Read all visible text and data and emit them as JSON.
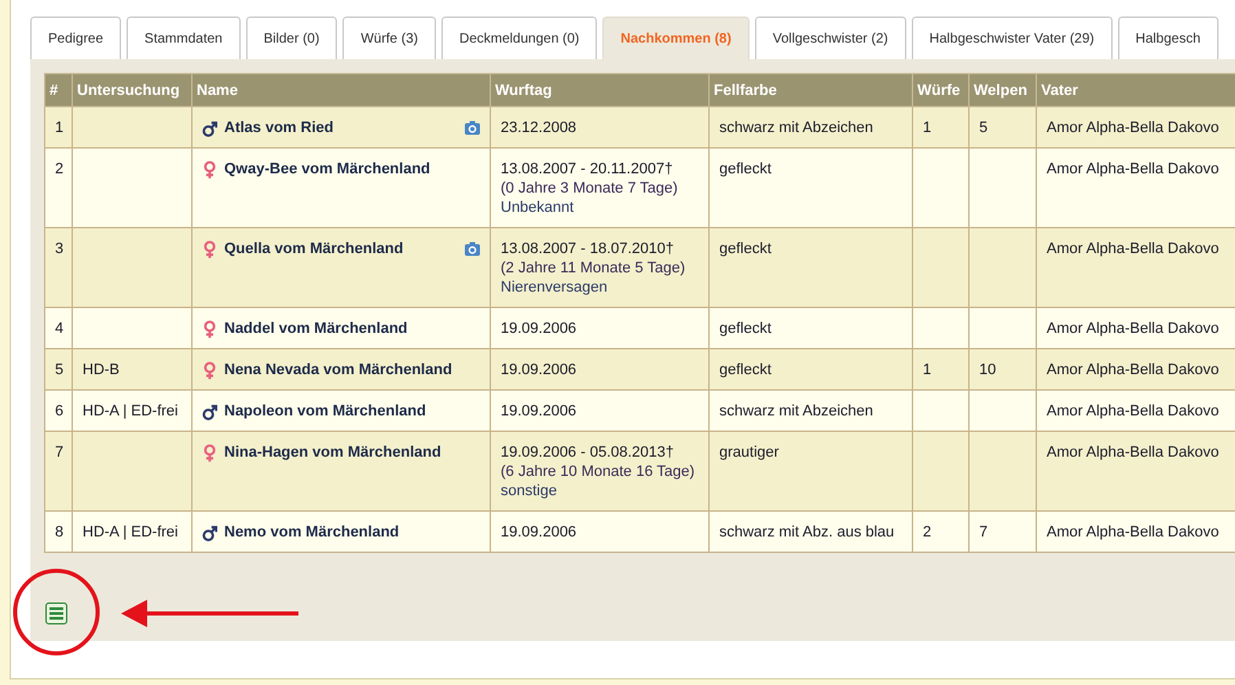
{
  "tabs": [
    {
      "label": "Pedigree",
      "selected": false
    },
    {
      "label": "Stammdaten",
      "selected": false
    },
    {
      "label": "Bilder (0)",
      "selected": false
    },
    {
      "label": "Würfe (3)",
      "selected": false
    },
    {
      "label": "Deckmeldungen (0)",
      "selected": false
    },
    {
      "label": "Nachkommen (8)",
      "selected": true
    },
    {
      "label": "Vollgeschwister (2)",
      "selected": false
    },
    {
      "label": "Halbgeschwister Vater (29)",
      "selected": false
    },
    {
      "label": "Halbgesch",
      "selected": false
    }
  ],
  "table": {
    "columns": [
      "#",
      "Untersuchung",
      "Name",
      "Wurftag",
      "Fellfarbe",
      "Würfe",
      "Welpen",
      "Vater"
    ],
    "rows": [
      {
        "number": "1",
        "name": "Atlas vom Ried",
        "kind": "male",
        "has_photo": true,
        "wurftag": [
          "23.12.2008"
        ],
        "fellfarbe": "schwarz mit Abzeichen",
        "wuerfe": "1",
        "welpen": "5",
        "vater": "Amor Alpha-Bella Dakovo"
      },
      {
        "number": "2",
        "name": "Qway-Bee vom Märchenland",
        "kind": "female",
        "has_photo": false,
        "wurftag": [
          "13.08.2007 - 20.11.2007†",
          "(0 Jahre 3 Monate 7 Tage)",
          "Unbekannt"
        ],
        "fellfarbe": "gefleckt",
        "vater": "Amor Alpha-Bella Dakovo"
      },
      {
        "number": "3",
        "name": "Quella vom Märchenland",
        "kind": "female",
        "has_photo": true,
        "wurftag": [
          "13.08.2007 - 18.07.2010†",
          "(2 Jahre 11 Monate 5 Tage)",
          "Nierenversagen"
        ],
        "fellfarbe": "gefleckt",
        "vater": "Amor Alpha-Bella Dakovo"
      },
      {
        "number": "4",
        "name": "Naddel vom Märchenland",
        "kind": "female",
        "has_photo": false,
        "wurftag": [
          "19.09.2006"
        ],
        "fellfarbe": "gefleckt",
        "vater": "Amor Alpha-Bella Dakovo"
      },
      {
        "number": "5",
        "untersuchung": "HD-B",
        "name": "Nena Nevada vom Märchenland",
        "kind": "female",
        "has_photo": false,
        "wurftag": [
          "19.09.2006"
        ],
        "fellfarbe": "gefleckt",
        "wuerfe": "1",
        "welpen": "10",
        "vater": "Amor Alpha-Bella Dakovo"
      },
      {
        "number": "6",
        "untersuchung": "HD-A | ED-frei",
        "name": "Napoleon vom Märchenland",
        "kind": "male",
        "has_photo": false,
        "wurftag": [
          "19.09.2006"
        ],
        "fellfarbe": "schwarz mit Abzeichen",
        "vater": "Amor Alpha-Bella Dakovo"
      },
      {
        "number": "7",
        "name": "Nina-Hagen vom Märchenland",
        "kind": "female",
        "has_photo": false,
        "wurftag": [
          "19.09.2006 - 05.08.2013†",
          "(6 Jahre 10 Monate 16 Tage)",
          "sonstige"
        ],
        "fellfarbe": "grautiger",
        "vater": "Amor Alpha-Bella Dakovo"
      },
      {
        "number": "8",
        "untersuchung": "HD-A | ED-frei",
        "name": "Nemo vom Märchenland",
        "kind": "male",
        "has_photo": false,
        "wurftag": [
          "19.09.2006"
        ],
        "fellfarbe": "schwarz mit Abz. aus blau",
        "wuerfe": "2",
        "welpen": "7",
        "vater": "Amor Alpha-Bella Dakovo"
      }
    ]
  }
}
